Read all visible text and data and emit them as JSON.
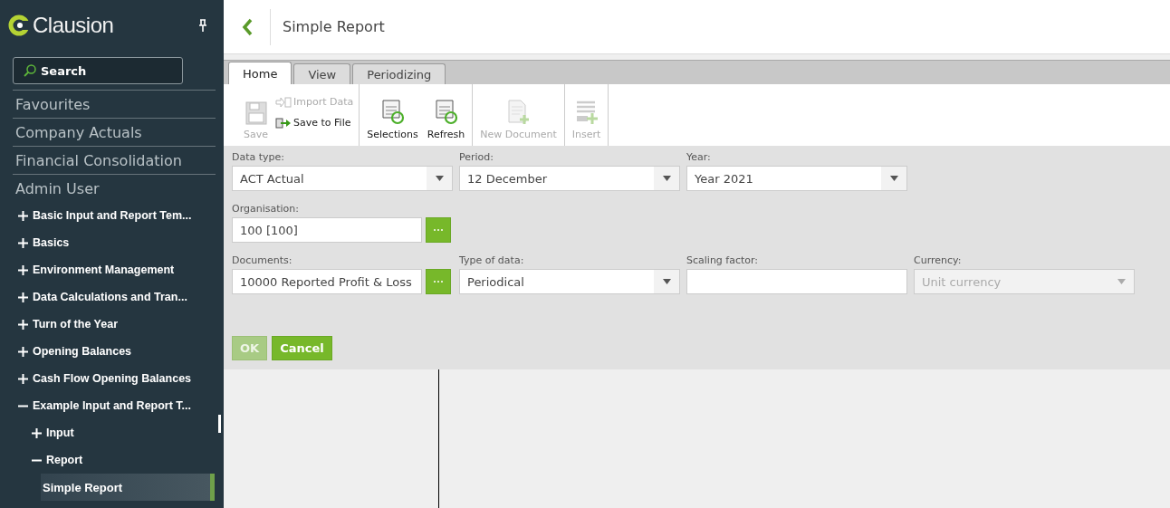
{
  "sidebar": {
    "logo": "Clausion",
    "search": {
      "placeholder": "Search"
    },
    "sections": [
      {
        "label": "Favourites"
      },
      {
        "label": "Company Actuals"
      },
      {
        "label": "Financial Consolidation"
      },
      {
        "label": "Admin User",
        "children": [
          {
            "label": "Basic Input and Report Tem...",
            "expanded": false,
            "selected": false
          },
          {
            "label": "Basics",
            "expanded": false,
            "selected": false
          },
          {
            "label": "Environment Management",
            "expanded": false,
            "selected": false
          },
          {
            "label": "Data Calculations and Tran...",
            "expanded": false,
            "selected": false
          },
          {
            "label": "Turn of the Year",
            "expanded": false,
            "selected": false
          },
          {
            "label": "Opening Balances",
            "expanded": false,
            "selected": false
          },
          {
            "label": "Cash Flow Opening Balances",
            "expanded": false,
            "selected": false
          },
          {
            "label": "Example Input and Report T...",
            "expanded": true,
            "selected": false,
            "children": [
              {
                "label": "Input",
                "expanded": false,
                "selected": false
              },
              {
                "label": "Report",
                "expanded": true,
                "selected": false,
                "children": [
                  {
                    "label": "Simple Report",
                    "selected": true
                  }
                ]
              }
            ]
          }
        ]
      }
    ]
  },
  "header": {
    "title": "Simple Report"
  },
  "tabs": [
    {
      "label": "Home",
      "selected": true
    },
    {
      "label": "View",
      "selected": false
    },
    {
      "label": "Periodizing",
      "selected": false
    }
  ],
  "toolbar": [
    [
      {
        "kind": "large",
        "label": "Save",
        "disabled": true
      },
      {
        "kind": "small",
        "label": "Import Data",
        "disabled": true
      },
      {
        "kind": "small",
        "label": "Save to File",
        "disabled": false
      }
    ],
    [
      {
        "kind": "large",
        "label": "Selections",
        "disabled": false
      },
      {
        "kind": "large",
        "label": "Refresh",
        "disabled": false
      }
    ],
    [
      {
        "kind": "large",
        "label": "New Document",
        "disabled": true
      }
    ],
    [
      {
        "kind": "large",
        "label": "Insert",
        "disabled": true
      }
    ]
  ],
  "form": [
    [
      {
        "kind": "select",
        "label": "Data type:",
        "value": "ACT Actual",
        "disabled": false
      },
      {
        "kind": "select",
        "label": "Period:",
        "value": "12 December",
        "disabled": false
      },
      {
        "kind": "select",
        "label": "Year:",
        "value": "Year 2021",
        "disabled": false
      }
    ],
    [
      {
        "kind": "lookup",
        "label": "Organisation:",
        "value": "100 [100]",
        "disabled": false
      }
    ],
    [
      {
        "kind": "lookup",
        "label": "Documents:",
        "value": "10000 Reported Profit & Loss",
        "disabled": false
      },
      {
        "kind": "select",
        "label": "Type of data:",
        "value": "Periodical",
        "disabled": false
      },
      {
        "kind": "input",
        "label": "Scaling factor:",
        "disabled": false
      },
      {
        "kind": "select",
        "label": "Currency:",
        "value": "Unit currency",
        "disabled": true
      }
    ]
  ],
  "buttons": [
    {
      "label": "OK",
      "disabled": true
    },
    {
      "label": "Cancel",
      "disabled": false
    }
  ]
}
